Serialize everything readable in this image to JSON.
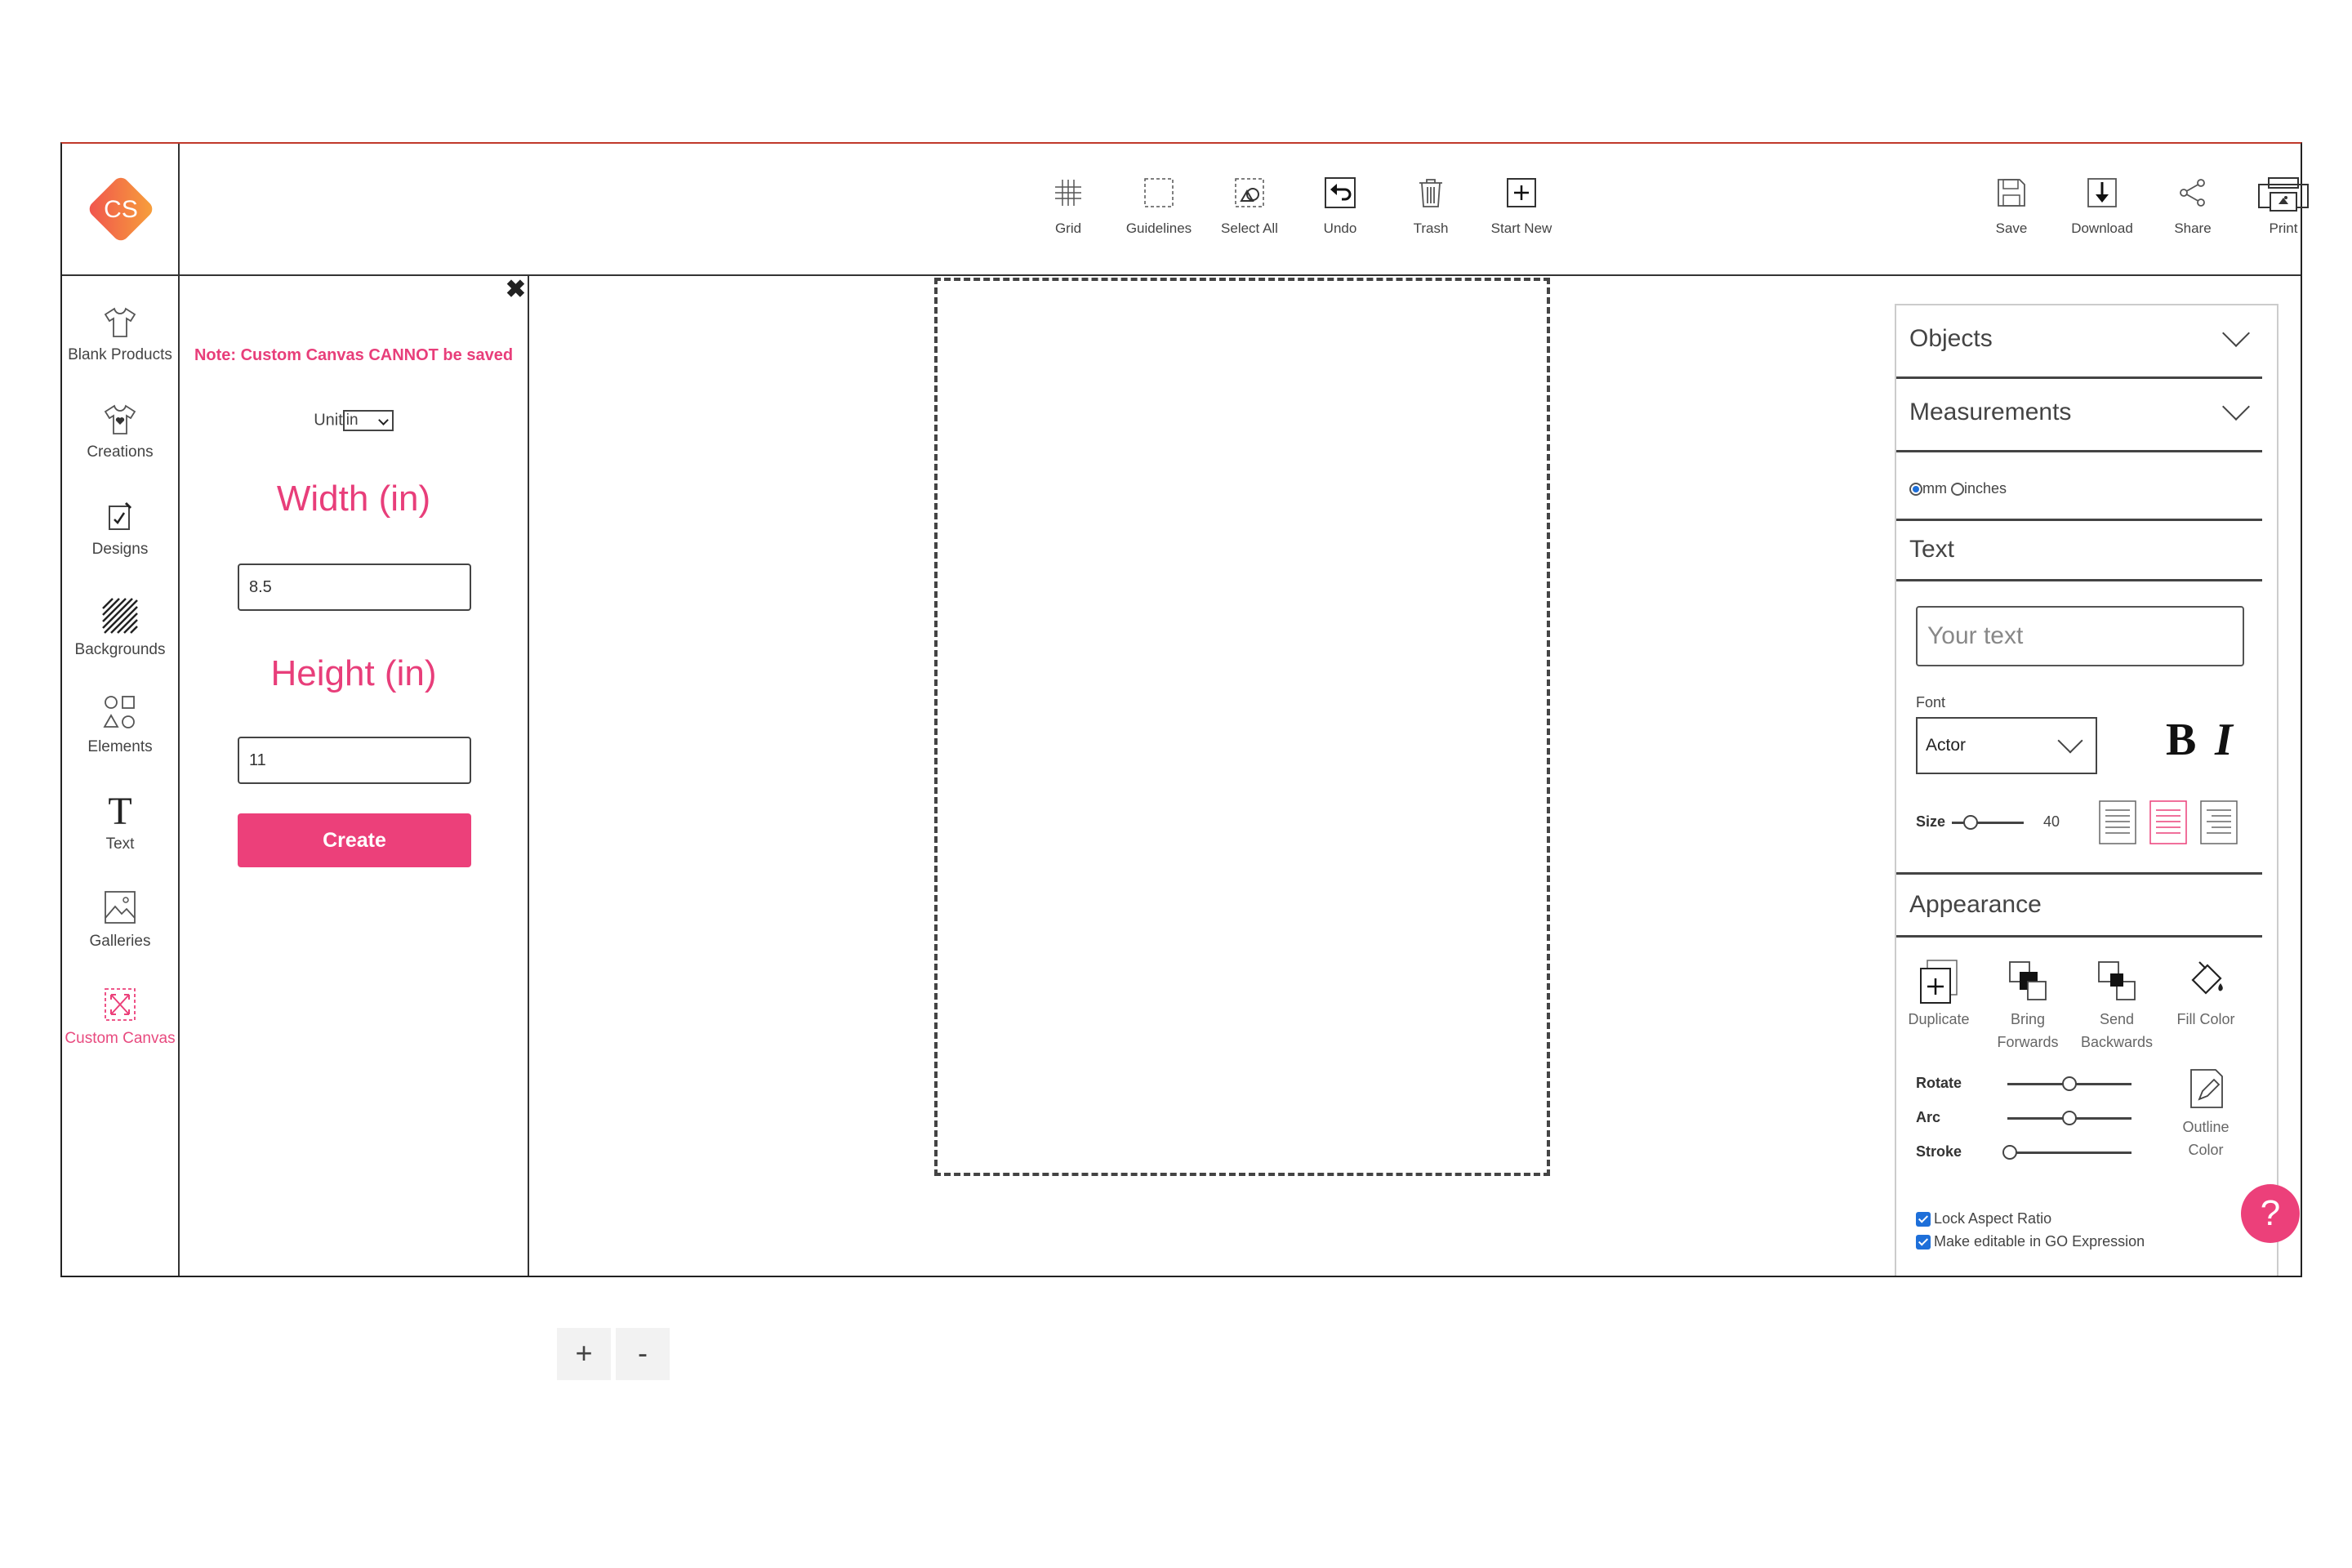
{
  "brand": {
    "logo_text": "CS",
    "accent": "#ec407a",
    "logo_gradient": [
      "#f0524e",
      "#f7a23a"
    ]
  },
  "toolbar": {
    "items": [
      {
        "label": "Grid",
        "icon": "grid-icon"
      },
      {
        "label": "Guidelines",
        "icon": "guidelines-icon"
      },
      {
        "label": "Select All",
        "icon": "select-all-icon"
      },
      {
        "label": "Undo",
        "icon": "undo-icon"
      },
      {
        "label": "Trash",
        "icon": "trash-icon"
      },
      {
        "label": "Start New",
        "icon": "start-new-icon"
      }
    ],
    "right_items": [
      {
        "label": "Save",
        "icon": "save-icon"
      },
      {
        "label": "Download",
        "icon": "download-icon"
      },
      {
        "label": "Share",
        "icon": "share-icon"
      },
      {
        "label": "Print",
        "icon": "print-icon"
      }
    ]
  },
  "sidebar": {
    "items": [
      {
        "label": "Blank Products",
        "icon": "tshirt-icon"
      },
      {
        "label": "Creations",
        "icon": "creations-icon"
      },
      {
        "label": "Designs",
        "icon": "designs-icon"
      },
      {
        "label": "Backgrounds",
        "icon": "backgrounds-icon"
      },
      {
        "label": "Elements",
        "icon": "elements-icon"
      },
      {
        "label": "Text",
        "icon": "text-icon"
      },
      {
        "label": "Galleries",
        "icon": "galleries-icon"
      },
      {
        "label": "Custom Canvas",
        "icon": "custom-canvas-icon",
        "active": true
      }
    ]
  },
  "custom_canvas": {
    "close": "✖",
    "note": "Note: Custom Canvas CANNOT be saved",
    "unit_label": "Unit",
    "unit_value": "in",
    "width_label": "Width (in)",
    "width_value": "8.5",
    "height_label": "Height (in)",
    "height_value": "11",
    "create_label": "Create"
  },
  "zoom": {
    "in": "+",
    "out": "-"
  },
  "right_panel": {
    "objects_title": "Objects",
    "measurements_title": "Measurements",
    "unit_mm": "mm",
    "unit_inches": "inches",
    "unit_selected": "mm",
    "text_title": "Text",
    "text_placeholder": "Your text",
    "font_label": "Font",
    "font_value": "Actor",
    "bold": "B",
    "italic": "I",
    "size_label": "Size",
    "size_value": "40",
    "appearance_title": "Appearance",
    "appearance_items": [
      {
        "line1": "Duplicate",
        "line2": ""
      },
      {
        "line1": "Bring",
        "line2": "Forwards"
      },
      {
        "line1": "Send",
        "line2": "Backwards"
      },
      {
        "line1": "Fill Color",
        "line2": ""
      }
    ],
    "rotate_label": "Rotate",
    "arc_label": "Arc",
    "stroke_label": "Stroke",
    "rotate_level": 0.5,
    "arc_level": 0.5,
    "stroke_level": 0,
    "outline_line1": "Outline",
    "outline_line2": "Color",
    "lock_aspect": "Lock Aspect Ratio",
    "editable_go": "Make editable in GO Expression"
  },
  "help": "?"
}
